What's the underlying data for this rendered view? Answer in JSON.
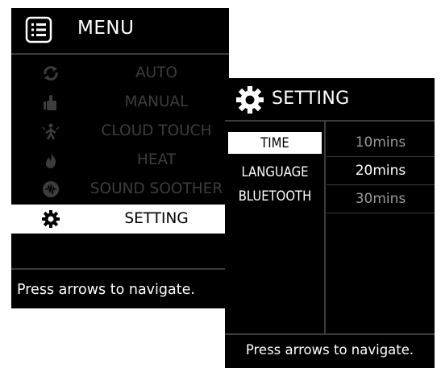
{
  "menu": {
    "title": "MENU",
    "header_icon": "menu-list-icon",
    "items": [
      {
        "label": "AUTO",
        "icon": "refresh-icon",
        "selected": false
      },
      {
        "label": "MANUAL",
        "icon": "thumbs-up-icon",
        "selected": false
      },
      {
        "label": "CLOUD TOUCH",
        "icon": "body-touch-icon",
        "selected": false
      },
      {
        "label": "HEAT",
        "icon": "flame-icon",
        "selected": false
      },
      {
        "label": "SOUND SOOTHER",
        "icon": "sound-wave-icon",
        "selected": false
      },
      {
        "label": "SETTING",
        "icon": "gear-icon",
        "selected": true
      }
    ],
    "hint": "Press arrows to navigate."
  },
  "setting": {
    "title": "SETTING",
    "header_icon": "gear-icon",
    "options": [
      {
        "label": "TIME",
        "selected": true
      },
      {
        "label": "LANGUAGE",
        "selected": false
      },
      {
        "label": "BLUETOOTH",
        "selected": false
      }
    ],
    "values": [
      {
        "label": "10mins",
        "highlighted": false
      },
      {
        "label": "20mins",
        "highlighted": true
      },
      {
        "label": "30mins",
        "highlighted": false
      }
    ],
    "hint": "Press arrows to navigate."
  },
  "colors": {
    "screen_bg": "#000000",
    "text_active": "#ffffff",
    "text_dim": "#3d3d3d",
    "value_dim": "#9a9a9a",
    "selection_bg": "#ffffff"
  }
}
